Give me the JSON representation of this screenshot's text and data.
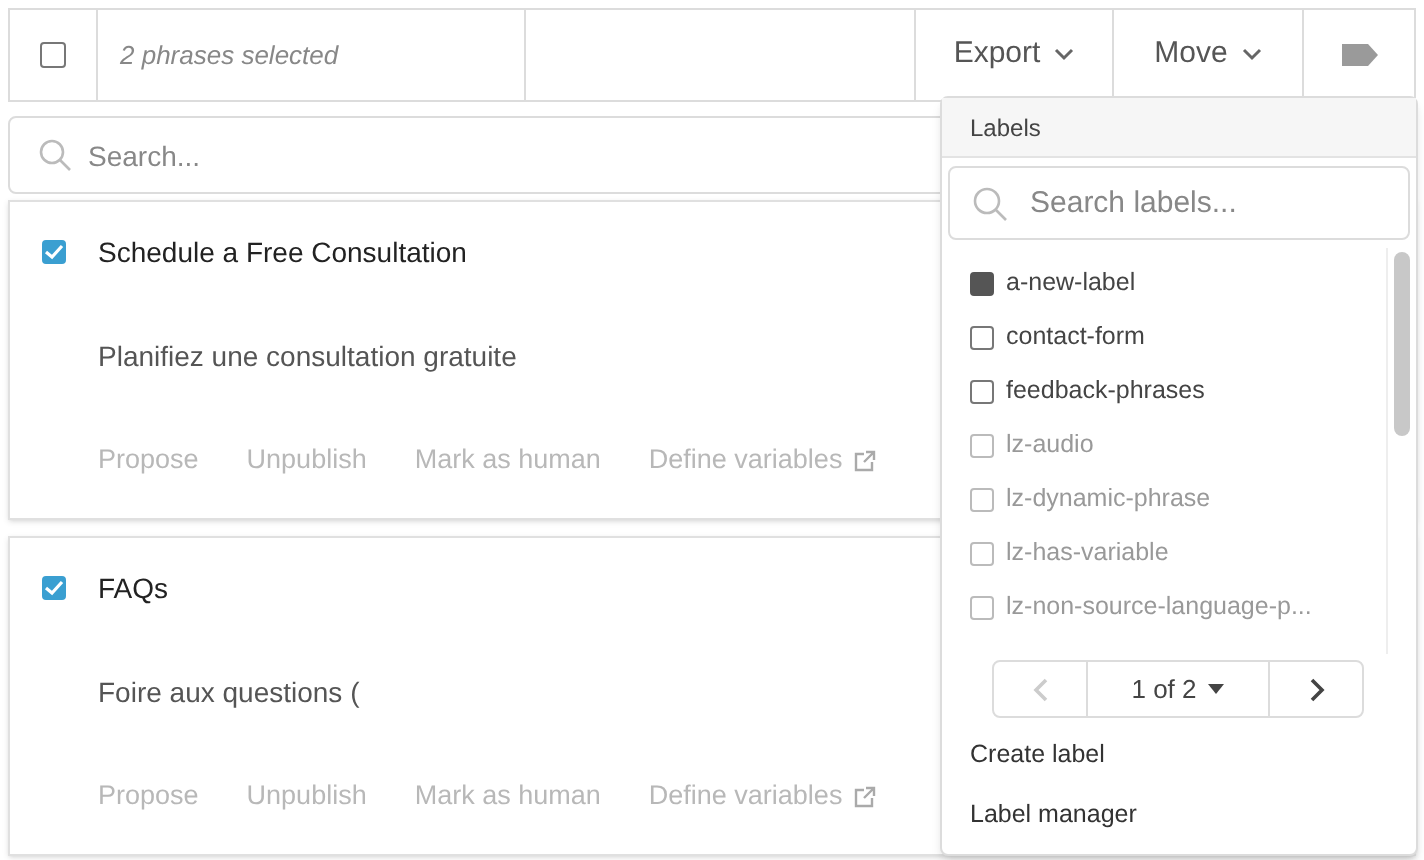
{
  "toolbar": {
    "select_all": {
      "checked": false
    },
    "selection_text": "2 phrases selected",
    "buttons": [
      {
        "label": "Export",
        "kind": "dropdown"
      },
      {
        "label": "Move",
        "kind": "dropdown"
      },
      {
        "kind": "label-icon"
      }
    ]
  },
  "search": {
    "placeholder": "Search..."
  },
  "phrases": [
    {
      "checked": true,
      "title": "Schedule a Free Consultation",
      "translation": "Planifiez une consultation gratuite",
      "actions": [
        "Propose",
        "Unpublish",
        "Mark as human",
        "Define variables"
      ]
    },
    {
      "checked": true,
      "title": "FAQs",
      "translation": "Foire aux questions (",
      "actions": [
        "Propose",
        "Unpublish",
        "Mark as human",
        "Define variables"
      ]
    }
  ],
  "labels_menu": {
    "title": "Labels",
    "search_placeholder": "Search labels...",
    "items": [
      {
        "label": "a-new-label",
        "checked": true,
        "disabled": false
      },
      {
        "label": "contact-form",
        "checked": false,
        "disabled": false
      },
      {
        "label": "feedback-phrases",
        "checked": false,
        "disabled": false
      },
      {
        "label": "lz-audio",
        "checked": false,
        "disabled": true
      },
      {
        "label": "lz-dynamic-phrase",
        "checked": false,
        "disabled": true
      },
      {
        "label": "lz-has-variable",
        "checked": false,
        "disabled": true
      },
      {
        "label": "lz-non-source-language-p...",
        "checked": false,
        "disabled": true
      }
    ],
    "pager": {
      "prev_disabled": true,
      "page": "1 of 2",
      "next_disabled": false
    },
    "links": [
      "Create label",
      "Label manager"
    ]
  }
}
